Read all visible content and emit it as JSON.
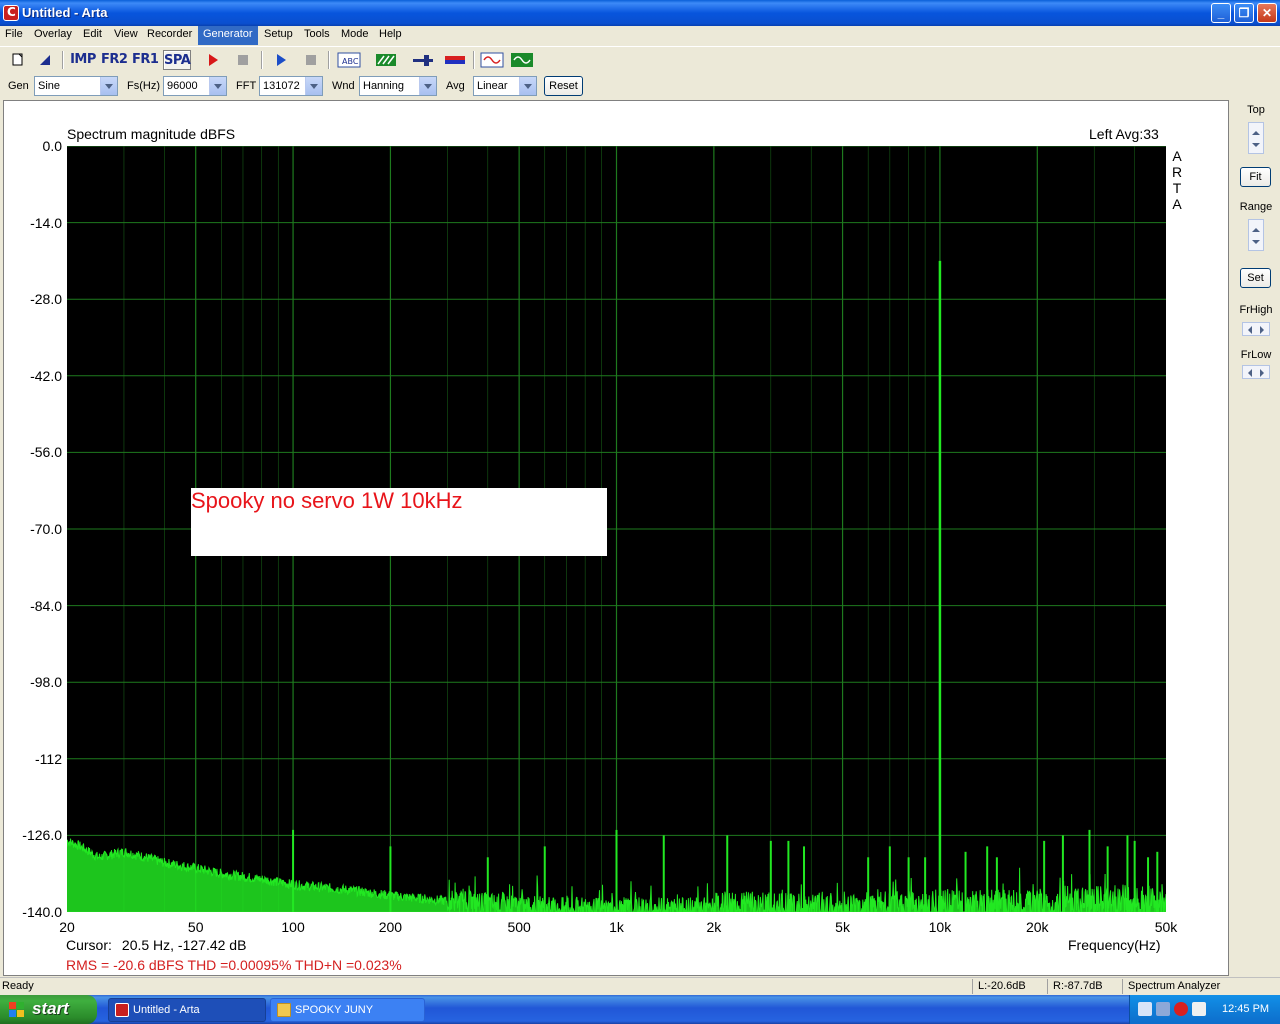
{
  "window": {
    "title": "Untitled - Arta",
    "minimize": "_",
    "restore": "❐",
    "close": "✕"
  },
  "menu": [
    "File",
    "Overlay",
    "Edit",
    "View",
    "Recorder",
    "Generator",
    "Setup",
    "Tools",
    "Mode",
    "Help"
  ],
  "menu_active": "Generator",
  "toolbar": {
    "imp": "IMP",
    "fr2": "FR2",
    "fr1": "FR1",
    "spa": "SPA"
  },
  "params": {
    "gen_label": "Gen",
    "gen_value": "Sine",
    "fs_label": "Fs(Hz)",
    "fs_value": "96000",
    "fft_label": "FFT",
    "fft_value": "131072",
    "wnd_label": "Wnd",
    "wnd_value": "Hanning",
    "avg_label": "Avg",
    "avg_value": "Linear",
    "reset": "Reset"
  },
  "plot": {
    "title": "Spectrum magnitude dBFS",
    "status": "Left  Avg:33",
    "brand": [
      "A",
      "R",
      "T",
      "A"
    ],
    "annotation": "Spooky no servo 1W 10kHz",
    "freq_label": "Frequency(Hz)",
    "cursor_label": "Cursor:",
    "cursor_value": "20.5 Hz, -127.42 dB",
    "measure": "RMS =  -20.6 dBFS   THD =0.00095%   THD+N =0.023%"
  },
  "side": {
    "top": "Top",
    "fit": "Fit",
    "range": "Range",
    "set": "Set",
    "frhigh": "FrHigh",
    "frlow": "FrLow"
  },
  "statusbar": {
    "ready": "Ready",
    "left": "L:-20.6dB",
    "right": "R:-87.7dB",
    "mode": "Spectrum Analyzer"
  },
  "taskbar": {
    "start": "start",
    "tasks": [
      "Untitled - Arta",
      "SPOOKY JUNY"
    ],
    "clock": "12:45 PM"
  },
  "colors": {
    "trace": "#22E822",
    "grid": "#1E7A1E",
    "annotation": "#E8141A",
    "measure": "#D42020"
  },
  "chart_data": {
    "type": "line",
    "title": "Spectrum magnitude dBFS",
    "xlabel": "Frequency(Hz)",
    "ylabel": "",
    "xscale": "log",
    "xlim": [
      20,
      50000
    ],
    "ylim": [
      -140,
      0
    ],
    "y_ticks": [
      "0.0",
      "-14.0",
      "-28.0",
      "-42.0",
      "-56.0",
      "-70.0",
      "-84.0",
      "-98.0",
      "-112",
      "-126.0",
      "-140.0"
    ],
    "y_tick_values": [
      0,
      -14,
      -28,
      -42,
      -56,
      -70,
      -84,
      -98,
      -112,
      -126,
      -140
    ],
    "x_ticks": [
      "20",
      "50",
      "100",
      "200",
      "500",
      "1k",
      "2k",
      "5k",
      "10k",
      "20k",
      "50k"
    ],
    "x_tick_values": [
      20,
      50,
      100,
      200,
      500,
      1000,
      2000,
      5000,
      10000,
      20000,
      50000
    ],
    "grid": true,
    "noise_floor": {
      "x": [
        20,
        22,
        25,
        30,
        35,
        40,
        50,
        60,
        80,
        100,
        150,
        200,
        300,
        500,
        700,
        1000,
        2000,
        5000,
        10000,
        20000,
        30000,
        40000,
        50000
      ],
      "y": [
        -127,
        -128,
        -130,
        -129,
        -130,
        -131,
        -132,
        -133,
        -134,
        -135,
        -136,
        -137,
        -138,
        -139,
        -139.5,
        -139.5,
        -139.5,
        -139.5,
        -139,
        -139,
        -138.5,
        -138,
        -139
      ]
    },
    "series": [
      {
        "x": [
          10000
        ],
        "y": [
          -21
        ]
      }
    ],
    "spurs": {
      "x": [
        100,
        200,
        400,
        600,
        1000,
        1400,
        2200,
        3000,
        3400,
        3800,
        6000,
        7000,
        8000,
        9000,
        12000,
        14000,
        15000,
        21000,
        24000,
        29000,
        33000,
        38000,
        40000,
        44000,
        47000
      ],
      "y": [
        -125,
        -128,
        -130,
        -128,
        -125,
        -126,
        -126,
        -127,
        -127,
        -128,
        -130,
        -128,
        -130,
        -130,
        -129,
        -128,
        -130,
        -127,
        -126,
        -125,
        -128,
        -126,
        -127,
        -130,
        -129
      ]
    }
  }
}
